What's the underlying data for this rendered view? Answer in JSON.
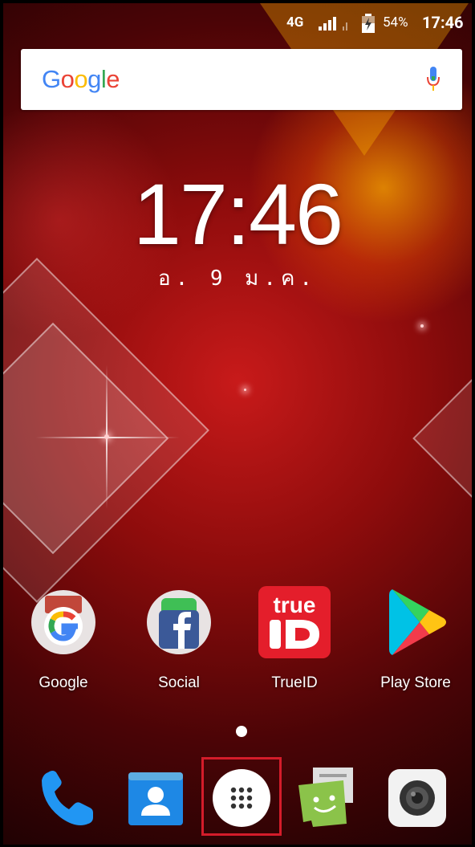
{
  "status_bar": {
    "network": "4G",
    "battery_percent": "54%",
    "time": "17:46"
  },
  "search": {
    "logo_letters": [
      {
        "char": "G",
        "color": "#4285F4"
      },
      {
        "char": "o",
        "color": "#EA4335"
      },
      {
        "char": "o",
        "color": "#FBBC05"
      },
      {
        "char": "g",
        "color": "#4285F4"
      },
      {
        "char": "l",
        "color": "#34A853"
      },
      {
        "char": "e",
        "color": "#EA4335"
      }
    ],
    "mic_icon": "microphone-icon"
  },
  "clock": {
    "time": "17:46",
    "date": "อ. 9 ม.ค."
  },
  "home_apps": [
    {
      "label": "Google",
      "icon": "google-folder-icon"
    },
    {
      "label": "Social",
      "icon": "social-folder-icon"
    },
    {
      "label": "TrueID",
      "icon": "trueid-icon"
    },
    {
      "label": "Play Store",
      "icon": "play-store-icon"
    }
  ],
  "dock": [
    {
      "name": "phone",
      "icon": "phone-icon"
    },
    {
      "name": "contacts",
      "icon": "contacts-icon"
    },
    {
      "name": "all-apps",
      "icon": "app-drawer-icon"
    },
    {
      "name": "messaging",
      "icon": "messaging-icon"
    },
    {
      "name": "camera",
      "icon": "camera-icon"
    }
  ],
  "colors": {
    "highlight": "#d41c2a",
    "trueid_red": "#e41e2b"
  }
}
